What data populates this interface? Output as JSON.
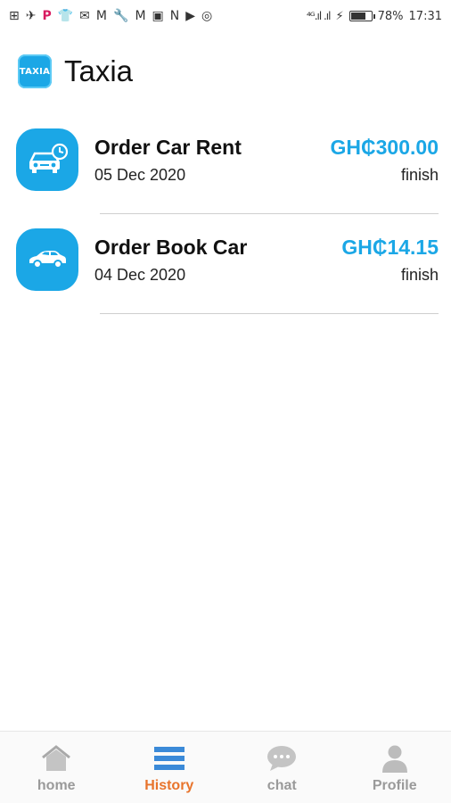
{
  "status_bar": {
    "battery_percent": "78%",
    "time": "17:31",
    "battery_level": 0.78
  },
  "app": {
    "logo_text": "TAXIA",
    "title": "Taxia"
  },
  "orders": [
    {
      "icon": "car-clock-icon",
      "title": "Order Car Rent",
      "date": "05 Dec 2020",
      "amount": "GH₵300.00",
      "status": "finish"
    },
    {
      "icon": "car-icon",
      "title": "Order Book Car",
      "date": "04 Dec 2020",
      "amount": "GH₵14.15",
      "status": "finish"
    }
  ],
  "bottom_nav": {
    "items": [
      {
        "label": "home",
        "icon": "home-icon",
        "active": false
      },
      {
        "label": "History",
        "icon": "history-icon",
        "active": true
      },
      {
        "label": "chat",
        "icon": "chat-icon",
        "active": false
      },
      {
        "label": "Profile",
        "icon": "profile-icon",
        "active": false
      }
    ]
  },
  "colors": {
    "accent": "#1ba7e6",
    "active_tab": "#e8742c",
    "inactive_tab": "#9a9a9a"
  }
}
